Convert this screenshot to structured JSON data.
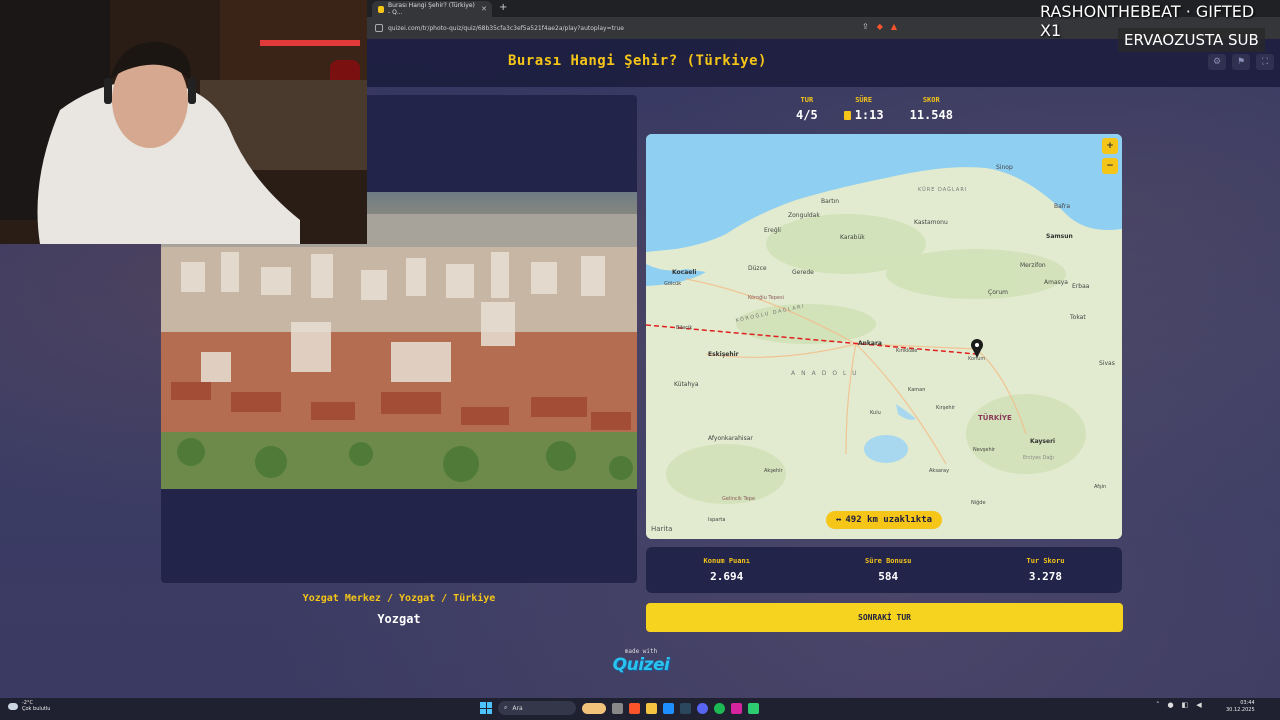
{
  "browser": {
    "tab_title": "Burası Hangi Şehir? (Türkiye) - Q...",
    "url": "quizei.com/tr/photo-quiz/quiz/68b35cfa3c3ef5a521f4ae2a/play?autoplay=true"
  },
  "page": {
    "title": "Burası Hangi Şehir? (Türkiye)"
  },
  "stats": {
    "round_label": "TUR",
    "round_value": "4/5",
    "time_label": "SÜRE",
    "time_value": "1:13",
    "score_label": "SKOR",
    "score_value": "11.548"
  },
  "answer": {
    "path": "Yozgat Merkez / Yozgat / Türkiye",
    "city": "Yozgat"
  },
  "map": {
    "distance_text": "492 km uzaklıkta",
    "attribution": "Harita",
    "labels": {
      "sinop": "Sinop",
      "kure": "KÜRE DAĞLARI",
      "bafra": "Bafra",
      "bartin": "Bartın",
      "zonguldak": "Zonguldak",
      "kastamonu": "Kastamonu",
      "samsun": "Samsun",
      "eregli": "Ereğli",
      "karabuk": "Karabük",
      "kocaeli": "Kocaeli",
      "duzce": "Düzce",
      "gerede": "Gerede",
      "merzifon": "Merzifon",
      "golcuk": "Gölcük",
      "bolu": "Köroğlu Tepesi",
      "corum": "Çorum",
      "amasya": "Amasya",
      "erbaa": "Erbaa",
      "koroglu": "KÖROĞLU DAĞLARI",
      "tokat": "Tokat",
      "bilecik": "Bilecik",
      "ankara": "Ankara",
      "kirikkale": "Kırıkkale",
      "konum": "Konum",
      "eskisehir": "Eskişehir",
      "sivas": "Sivas",
      "anadolu": "ANADOLU",
      "kutahya": "Kütahya",
      "kaman": "Kaman",
      "kirsehir": "Kırşehir",
      "turkiye": "TÜRKİYE",
      "kulu": "Kulu",
      "kayseri": "Kayseri",
      "afyon": "Afyonkarahisar",
      "nevsehir": "Nevşehir",
      "erciyes": "Erciyes Dağı",
      "aksehir": "Akşehir",
      "aksaray": "Aksaray",
      "afsin": "Afşin",
      "gelincik": "Gelincik Tepe",
      "nigde": "Niğde",
      "isparta": "Isparta"
    }
  },
  "scores": {
    "location_label": "Konum Puanı",
    "location_value": "2.694",
    "time_bonus_label": "Süre Bonusu",
    "time_bonus_value": "584",
    "round_score_label": "Tur Skoru",
    "round_score_value": "3.278"
  },
  "next_button": "SONRAKİ TUR",
  "footer": {
    "made_with": "made with",
    "brand": "Quizei"
  },
  "overlay": {
    "stream_text": "RASHONTHEBEAT · GIFTED X1",
    "stream_sub": "ERVAOZUSTA  SUB"
  },
  "taskbar": {
    "weather_temp": "-2°C",
    "weather_desc": "Çok bulutlu",
    "search": "Ara",
    "time": "03:44",
    "date": "30.12.2025"
  },
  "colors": {
    "accent": "#f5c518",
    "panel": "#22244a",
    "logo": "#28c4f0"
  }
}
